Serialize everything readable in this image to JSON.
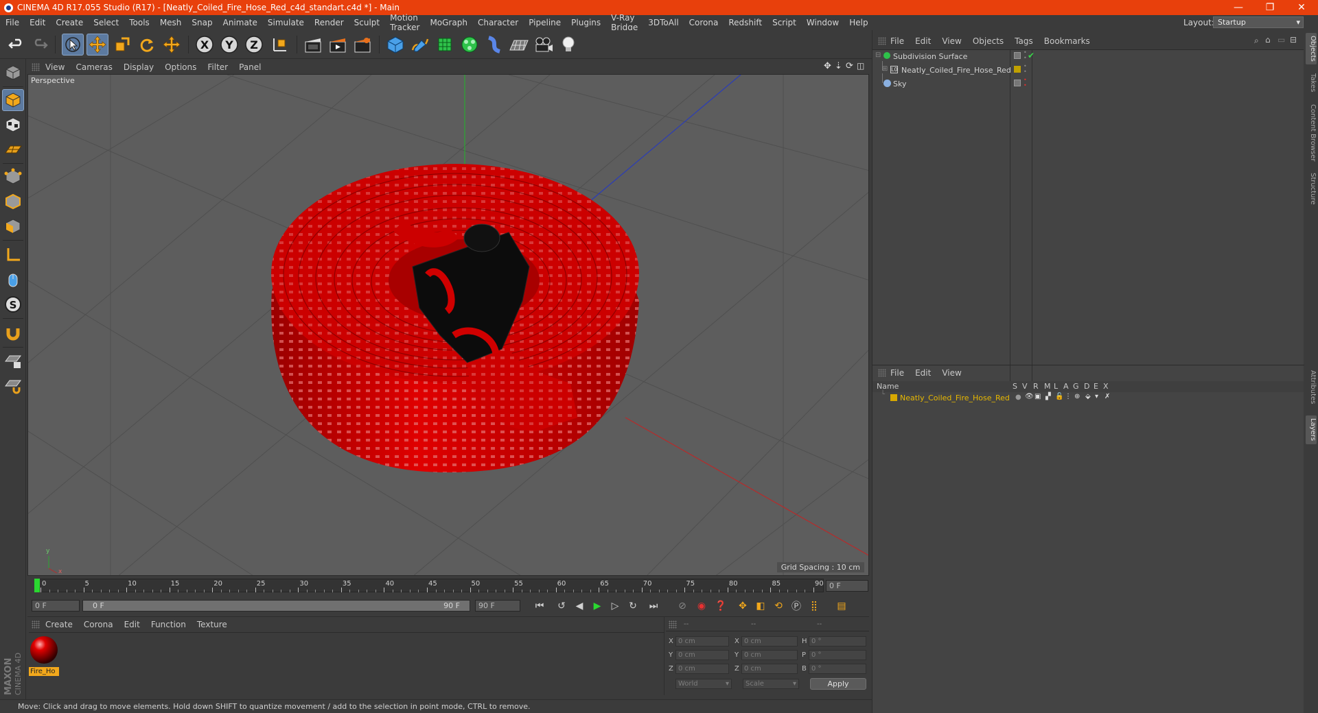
{
  "window": {
    "title": "CINEMA 4D R17.055 Studio (R17) - [Neatly_Coiled_Fire_Hose_Red_c4d_standart.c4d *] - Main",
    "minimize": "—",
    "restore": "❐",
    "close": "✕"
  },
  "menu": [
    "File",
    "Edit",
    "Create",
    "Select",
    "Tools",
    "Mesh",
    "Snap",
    "Animate",
    "Simulate",
    "Render",
    "Sculpt",
    "Motion Tracker",
    "MoGraph",
    "Character",
    "Pipeline",
    "Plugins",
    "V-Ray Bridge",
    "3DToAll",
    "Corona",
    "Redshift",
    "Script",
    "Window",
    "Help"
  ],
  "layout": {
    "label": "Layout:",
    "value": "Startup"
  },
  "viewport": {
    "menu": [
      "View",
      "Cameras",
      "Display",
      "Options",
      "Filter",
      "Panel"
    ],
    "label": "Perspective",
    "grid_spacing": "Grid Spacing : 10 cm",
    "axis_y": "y",
    "axis_x": "x"
  },
  "timeline": {
    "ticks": [
      "0",
      "5",
      "10",
      "15",
      "20",
      "25",
      "30",
      "35",
      "40",
      "45",
      "50",
      "55",
      "60",
      "65",
      "70",
      "75",
      "80",
      "85",
      "90"
    ],
    "current_frame": "0 F"
  },
  "transport": {
    "start": "0 F",
    "range_start": "0 F",
    "range_end": "90 F",
    "end": "90 F"
  },
  "material_panel": {
    "menu": [
      "Create",
      "Corona",
      "Edit",
      "Function",
      "Texture"
    ],
    "material_name": "Fire_Ho"
  },
  "coords": {
    "header": [
      "--",
      "--",
      "--"
    ],
    "rows": [
      {
        "a": "X",
        "av": "0 cm",
        "b": "X",
        "bv": "0 cm",
        "c": "H",
        "cv": "0 °"
      },
      {
        "a": "Y",
        "av": "0 cm",
        "b": "Y",
        "bv": "0 cm",
        "c": "P",
        "cv": "0 °"
      },
      {
        "a": "Z",
        "av": "0 cm",
        "b": "Z",
        "bv": "0 cm",
        "c": "B",
        "cv": "0 °"
      }
    ],
    "world": "World",
    "scale": "Scale",
    "apply": "Apply"
  },
  "status": "Move: Click and drag to move elements. Hold down SHIFT to quantize movement / add to the selection in point mode, CTRL to remove.",
  "maxon": {
    "line1": "MAXON",
    "line2": "CINEMA 4D"
  },
  "objects": {
    "menu": [
      "File",
      "Edit",
      "View",
      "Objects",
      "Tags",
      "Bookmarks"
    ],
    "items": [
      {
        "name": "Subdivision Surface"
      },
      {
        "name": "Neatly_Coiled_Fire_Hose_Red"
      },
      {
        "name": "Sky"
      }
    ]
  },
  "layers": {
    "menu": [
      "File",
      "Edit",
      "View"
    ],
    "columns": [
      "Name",
      "S",
      "V",
      "R",
      "M",
      "L",
      "A",
      "G",
      "D",
      "E",
      "X"
    ],
    "items": [
      {
        "name": "Neatly_Coiled_Fire_Hose_Red",
        "color": "#d7a800"
      }
    ]
  },
  "side_tabs": [
    "Objects",
    "Takes",
    "Content Browser",
    "Structure",
    "Attributes",
    "Layers"
  ],
  "colors": {
    "title_bar": "#e8400c",
    "accent": "#5c7aa0",
    "hose": "#d10000"
  }
}
